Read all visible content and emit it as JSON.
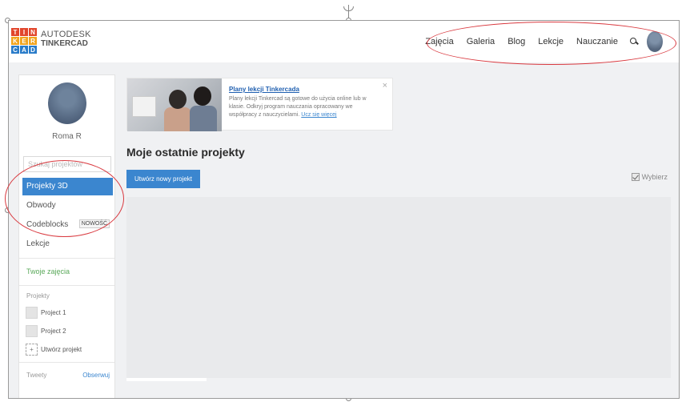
{
  "brand": {
    "logo_letters": [
      "T",
      "I",
      "N",
      "K",
      "E",
      "R",
      "C",
      "A",
      "D"
    ],
    "logo_colors": [
      "#e2462c",
      "#e2462c",
      "#e2462c",
      "#f2a51e",
      "#f2a51e",
      "#f2a51e",
      "#2a7cc9",
      "#2a7cc9",
      "#2a7cc9"
    ],
    "line1": "AUTODESK",
    "line2": "TINKERCAD"
  },
  "nav": {
    "items": [
      "Zajęcia",
      "Galeria",
      "Blog",
      "Lekcje",
      "Nauczanie"
    ],
    "search_icon": "search-icon",
    "avatar_icon": "user-avatar"
  },
  "sidebar": {
    "user_name": "Roma R",
    "search_placeholder": "Szukaj projektów",
    "items": [
      {
        "label": "Projekty 3D",
        "active": true
      },
      {
        "label": "Obwody",
        "active": false
      },
      {
        "label": "Codeblocks",
        "active": false,
        "badge": "NOWOŚĆ"
      },
      {
        "label": "Lekcje",
        "active": false
      }
    ],
    "classes_link": "Twoje zajęcia",
    "projects_label": "Projekty",
    "projects": [
      "Project 1",
      "Project 2"
    ],
    "new_project": "Utwórz projekt",
    "new_project_glyph": "+",
    "tweets_label": "Tweety",
    "follow_link": "Obserwuj"
  },
  "banner": {
    "title": "Plany lekcji Tinkercada",
    "body": "Plany lekcji Tinkercad są gotowe do użycia online lub w klasie. Odkryj program nauczania opracowany we współpracy z nauczycielami.",
    "link": "Ucz się więcej",
    "close": "×"
  },
  "main": {
    "title": "Moje ostatnie projekty",
    "new_project_button": "Utwórz nowy projekt",
    "select_label": "Wybierz"
  },
  "colors": {
    "accent": "#3b86cf",
    "annotation": "#d9393f",
    "classes_green": "#5aa95a"
  }
}
